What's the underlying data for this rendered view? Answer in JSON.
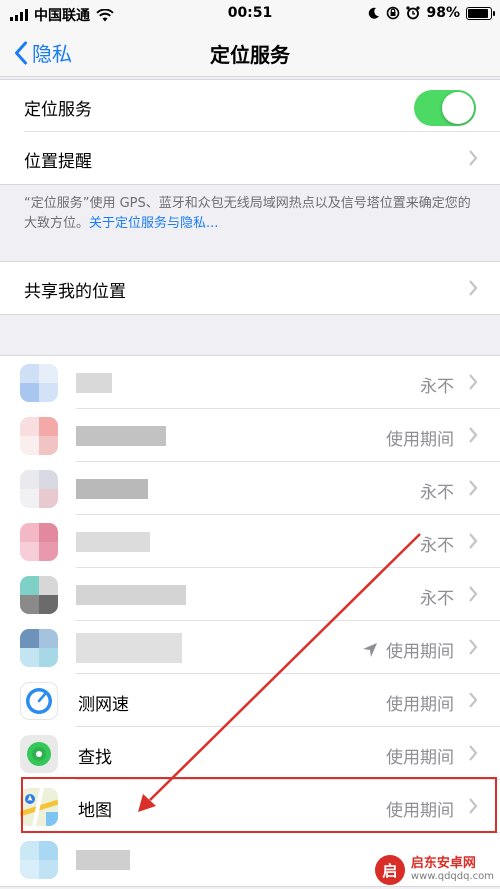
{
  "status_bar": {
    "carrier": "中国联通",
    "time": "00:51",
    "battery": "98%",
    "icons": [
      "signal-icon",
      "wifi-icon",
      "moon-icon",
      "rotation-lock-icon",
      "alarm-icon",
      "battery-icon"
    ]
  },
  "nav": {
    "back_label": "隐私",
    "title": "定位服务"
  },
  "location_group": {
    "location_services_label": "定位服务",
    "location_services_on": true,
    "location_alerts_label": "位置提醒"
  },
  "footnote": {
    "text": "“定位服务”使用 GPS、蓝牙和众包无线局域网热点以及信号塔位置来确定您的大致方位。",
    "link": "关于定位服务与隐私..."
  },
  "share": {
    "label": "共享我的位置"
  },
  "apps": [
    {
      "name": "",
      "status": "永不",
      "redacted": true
    },
    {
      "name": "",
      "status": "使用期间",
      "redacted": true
    },
    {
      "name": "",
      "status": "永不",
      "redacted": true
    },
    {
      "name": "",
      "status": "永不",
      "redacted": true
    },
    {
      "name": "",
      "status": "永不",
      "redacted": true
    },
    {
      "name": "",
      "status": "使用期间",
      "redacted": true,
      "location_arrow": true
    },
    {
      "name": "测网速",
      "status": "使用期间",
      "redacted": false
    },
    {
      "name": "查找",
      "status": "使用期间",
      "redacted": false
    },
    {
      "name": "地图",
      "status": "使用期间",
      "redacted": false
    },
    {
      "name": "",
      "status": "",
      "redacted": true
    }
  ],
  "colors": {
    "accent": "#1a7cf5",
    "toggle_on": "#4cd964",
    "annotation_red": "#d9302c",
    "background": "#efeff4"
  },
  "watermark": {
    "logo_text": "启",
    "title": "启东安卓网",
    "url": "www.qdqdq.com"
  }
}
